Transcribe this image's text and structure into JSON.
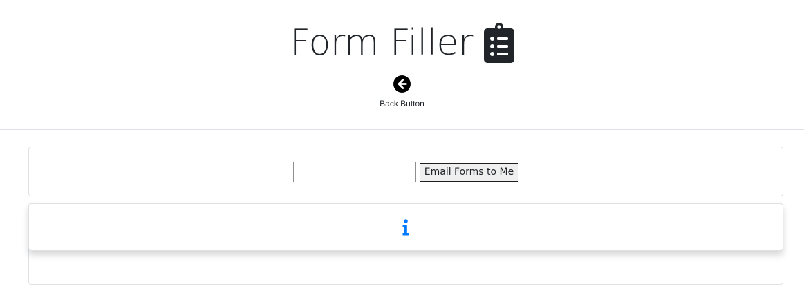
{
  "header": {
    "title": "Form Filler",
    "title_icon": "clipboard-list-icon",
    "back_icon": "arrow-circle-left-icon",
    "back_label": "Back Button"
  },
  "email_form": {
    "input_value": "",
    "submit_label": "Email Forms to Me"
  },
  "info_panel": {
    "icon": "info-icon",
    "icon_color": "#007bff"
  },
  "colors": {
    "text": "#212529",
    "accent": "#007bff",
    "border": "#dee2e6"
  }
}
